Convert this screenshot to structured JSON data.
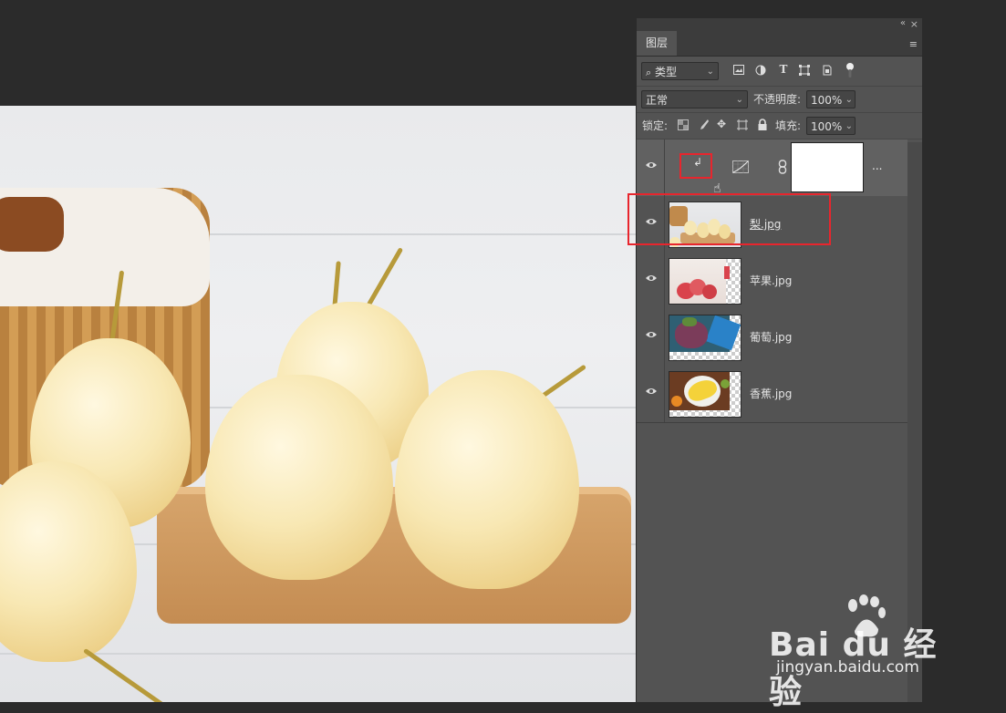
{
  "panel": {
    "collapse_icon": "«",
    "close_icon": "×",
    "tab_label": "图层",
    "menu_icon": "≡"
  },
  "filter": {
    "kind_label": "类型",
    "icons": [
      "image-filter-icon",
      "adjustment-filter-icon",
      "type-filter-icon",
      "shape-filter-icon",
      "smart-object-filter-icon",
      "filter-toggle-icon"
    ]
  },
  "blend": {
    "mode": "正常",
    "opacity_label": "不透明度:",
    "opacity_value": "100%"
  },
  "lock": {
    "label": "锁定:",
    "fill_label": "填充:",
    "fill_value": "100%"
  },
  "adjustment_layer": {
    "more_label": "..."
  },
  "layers": [
    {
      "name": "梨.jpg",
      "selected": true
    },
    {
      "name": "苹果.jpg"
    },
    {
      "name": "葡萄.jpg"
    },
    {
      "name": "香蕉.jpg"
    }
  ],
  "colors": {
    "highlight_box": "#e8252d",
    "panel_bg": "#535353",
    "canvas_bg": "#2b2b2b"
  },
  "watermark": {
    "brand": "Bai du 经验",
    "url": "jingyan.baidu.com"
  }
}
